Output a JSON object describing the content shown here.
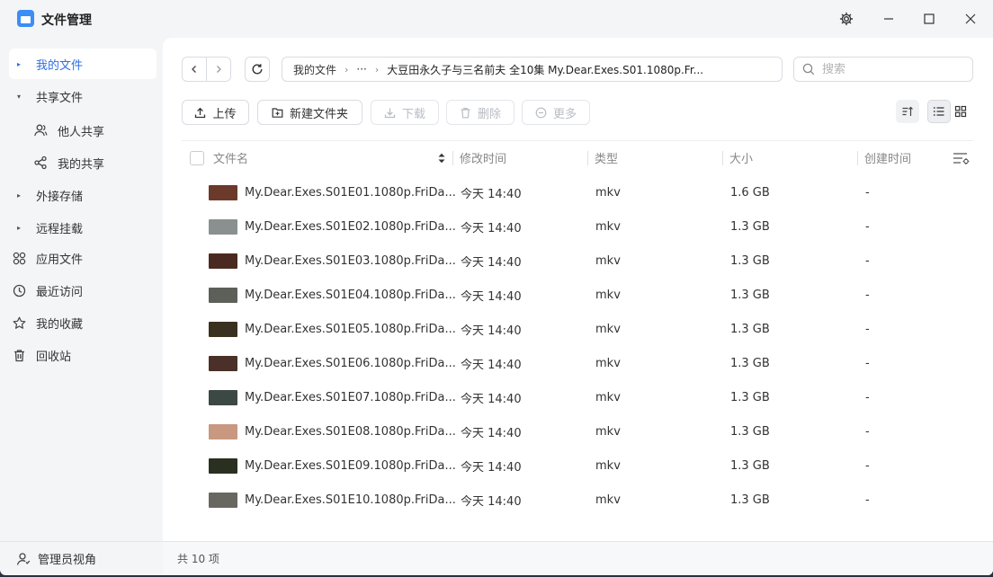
{
  "window": {
    "title": "文件管理",
    "controls": [
      "settings-icon",
      "minimize-icon",
      "maximize-icon",
      "close-icon"
    ]
  },
  "sidebar": {
    "items": [
      {
        "label": "我的文件",
        "icon": "caret-right-icon",
        "active": true
      },
      {
        "label": "共享文件",
        "icon": "caret-down-icon",
        "active": false
      },
      {
        "label": "他人共享",
        "icon": "users-icon",
        "sub": true
      },
      {
        "label": "我的共享",
        "icon": "share-icon",
        "sub": true
      },
      {
        "label": "外接存储",
        "icon": "caret-right-icon"
      },
      {
        "label": "远程挂载",
        "icon": "caret-right-icon"
      },
      {
        "label": "应用文件",
        "icon": "apps-icon"
      },
      {
        "label": "最近访问",
        "icon": "clock-icon"
      },
      {
        "label": "我的收藏",
        "icon": "star-icon"
      },
      {
        "label": "回收站",
        "icon": "trash-icon"
      }
    ],
    "footer": {
      "label": "管理员视角",
      "icon": "admin-user-icon"
    }
  },
  "pathbar": {
    "root": "我的文件",
    "ellipsis": "···",
    "current": "大豆田永久子与三名前夫 全10集 My.Dear.Exes.S01.1080p.Fr..."
  },
  "search": {
    "placeholder": "搜索",
    "value": ""
  },
  "toolbar": {
    "upload": "上传",
    "new_folder": "新建文件夹",
    "download": "下载",
    "delete": "删除",
    "more": "更多"
  },
  "table": {
    "columns": {
      "name": "文件名",
      "modified": "修改时间",
      "type": "类型",
      "size": "大小",
      "created": "创建时间"
    },
    "rows": [
      {
        "name": "My.Dear.Exes.S01E01.1080p.FriDa...",
        "modified": "今天 14:40",
        "type": "mkv",
        "size": "1.6 GB",
        "created": "-",
        "thumb": "#6b3a2a"
      },
      {
        "name": "My.Dear.Exes.S01E02.1080p.FriDa...",
        "modified": "今天 14:40",
        "type": "mkv",
        "size": "1.3 GB",
        "created": "-",
        "thumb": "#8a9090"
      },
      {
        "name": "My.Dear.Exes.S01E03.1080p.FriDa...",
        "modified": "今天 14:40",
        "type": "mkv",
        "size": "1.3 GB",
        "created": "-",
        "thumb": "#4a2a20"
      },
      {
        "name": "My.Dear.Exes.S01E04.1080p.FriDa...",
        "modified": "今天 14:40",
        "type": "mkv",
        "size": "1.3 GB",
        "created": "-",
        "thumb": "#5c6058"
      },
      {
        "name": "My.Dear.Exes.S01E05.1080p.FriDa...",
        "modified": "今天 14:40",
        "type": "mkv",
        "size": "1.3 GB",
        "created": "-",
        "thumb": "#3a3020"
      },
      {
        "name": "My.Dear.Exes.S01E06.1080p.FriDa...",
        "modified": "今天 14:40",
        "type": "mkv",
        "size": "1.3 GB",
        "created": "-",
        "thumb": "#4a3028"
      },
      {
        "name": "My.Dear.Exes.S01E07.1080p.FriDa...",
        "modified": "今天 14:40",
        "type": "mkv",
        "size": "1.3 GB",
        "created": "-",
        "thumb": "#3c4844"
      },
      {
        "name": "My.Dear.Exes.S01E08.1080p.FriDa...",
        "modified": "今天 14:40",
        "type": "mkv",
        "size": "1.3 GB",
        "created": "-",
        "thumb": "#c89880"
      },
      {
        "name": "My.Dear.Exes.S01E09.1080p.FriDa...",
        "modified": "今天 14:40",
        "type": "mkv",
        "size": "1.3 GB",
        "created": "-",
        "thumb": "#2a3020"
      },
      {
        "name": "My.Dear.Exes.S01E10.1080p.FriDa...",
        "modified": "今天 14:40",
        "type": "mkv",
        "size": "1.3 GB",
        "created": "-",
        "thumb": "#686860"
      }
    ]
  },
  "status": {
    "count": "共 10 项"
  },
  "colors": {
    "accent": "#2f6fe0",
    "sidebar_bg": "#f4f5f7",
    "main_bg": "#ffffff"
  }
}
